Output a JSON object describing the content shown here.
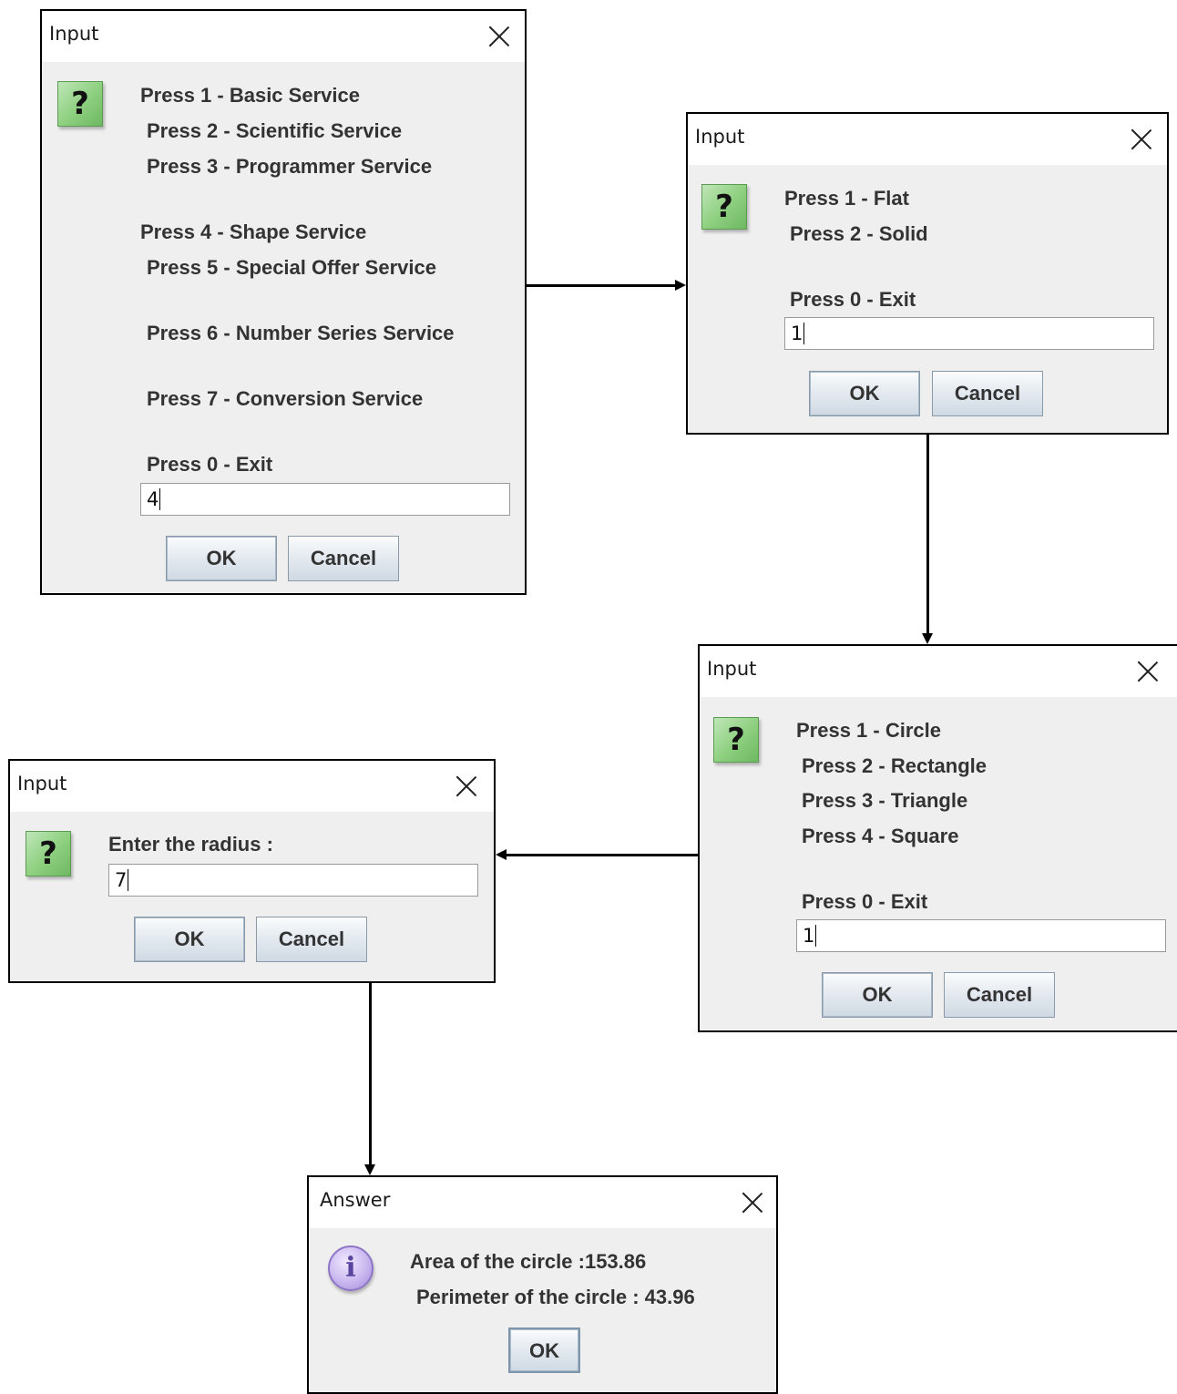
{
  "dialogs": {
    "main_menu": {
      "title": "Input",
      "lines": [
        "Press 1 - Basic Service",
        "Press 2 - Scientific Service",
        "Press 3 - Programmer Service",
        "Press 4 - Shape Service",
        "Press 5 - Special Offer Service",
        "Press 6 - Number Series Service",
        "Press 7 - Conversion Service",
        "Press 0 - Exit"
      ],
      "input_value": "4",
      "ok_label": "OK",
      "cancel_label": "Cancel"
    },
    "shape_type": {
      "title": "Input",
      "lines": [
        "Press 1 - Flat",
        "Press 2 - Solid",
        "Press 0 - Exit"
      ],
      "input_value": "1",
      "ok_label": "OK",
      "cancel_label": "Cancel"
    },
    "flat_shape": {
      "title": "Input",
      "lines": [
        "Press 1 - Circle",
        "Press 2 - Rectangle",
        "Press 3 - Triangle",
        "Press 4 - Square",
        "Press 0 - Exit"
      ],
      "input_value": "1",
      "ok_label": "OK",
      "cancel_label": "Cancel"
    },
    "radius": {
      "title": "Input",
      "prompt": "Enter the radius :",
      "input_value": "7",
      "ok_label": "OK",
      "cancel_label": "Cancel"
    },
    "answer": {
      "title": "Answer",
      "lines": [
        "Area of the circle :153.86",
        "Perimeter of the circle : 43.96"
      ],
      "ok_label": "OK"
    }
  },
  "icons": {
    "question": "question-icon",
    "information": "information-icon",
    "close": "close-icon"
  },
  "colors": {
    "dialog_background": "#efefef",
    "question_icon": "#8ccf7e",
    "info_icon": "#c9b7ef"
  }
}
